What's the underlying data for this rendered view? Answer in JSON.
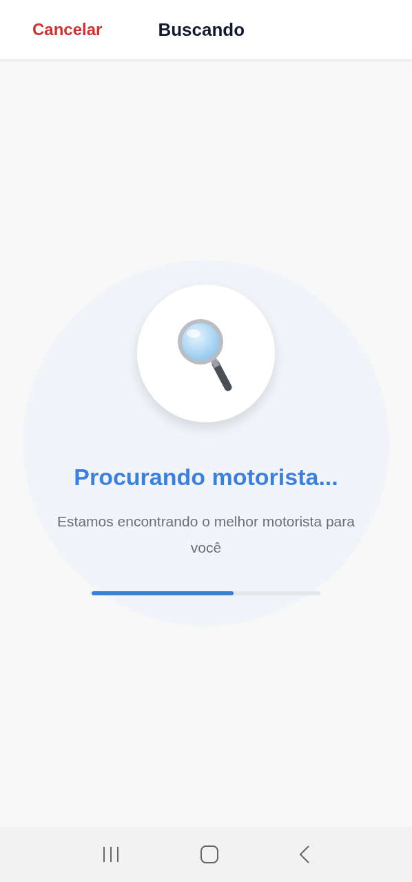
{
  "header": {
    "cancel": "Cancelar",
    "title": "Buscando"
  },
  "search": {
    "title": "Procurando motorista...",
    "message": "Estamos encontrando o melhor motorista para você",
    "progress": {
      "level": 0.62
    }
  }
}
